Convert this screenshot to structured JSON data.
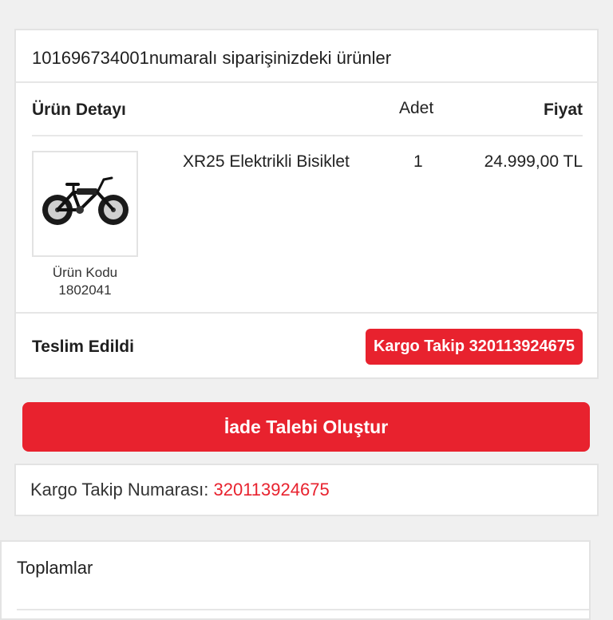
{
  "order": {
    "title": "101696734001numaralı siparişinizdeki ürünler",
    "headers": {
      "detail": "Ürün Detayı",
      "quantity": "Adet",
      "price": "Fiyat"
    },
    "item": {
      "name": "XR25 Elektrikli Bisiklet",
      "quantity": "1",
      "price": "24.999,00 TL",
      "code_label": "Ürün Kodu",
      "code": "1802041",
      "image": "electric-bicycle-image"
    },
    "status": "Teslim Edildi",
    "tracking_button": "Kargo Takip 320113924675"
  },
  "return_button": "İade Talebi Oluştur",
  "tracking": {
    "label": "Kargo Takip Numarası:",
    "number": "320113924675"
  },
  "totals": {
    "title": "Toplamlar"
  },
  "colors": {
    "accent": "#e8222e",
    "background": "#f0f0f0",
    "card": "#ffffff",
    "border": "#e3e3e3"
  }
}
